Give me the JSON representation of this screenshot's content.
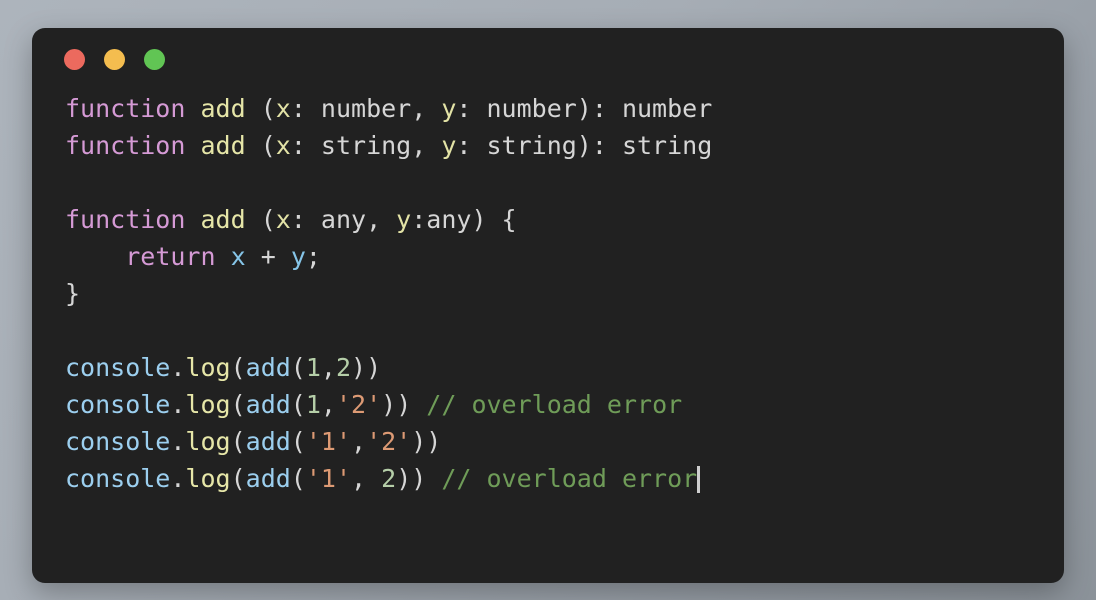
{
  "window": {
    "title": "code-snippet-window",
    "background_color": "#212121",
    "page_background": "#a8afb7",
    "controls": [
      {
        "name": "close-button",
        "label": "Close",
        "color": "#ec6a5e"
      },
      {
        "name": "minimize-button",
        "label": "Minimize",
        "color": "#f4bd4f"
      },
      {
        "name": "maximize-button",
        "label": "Maximize",
        "color": "#61c554"
      }
    ]
  },
  "editor": {
    "language": "typescript",
    "cursor_visible": true,
    "colors": {
      "keyword": "#d59ad5",
      "function_name": "#e6e6a8",
      "parameter": "#e3e3a6",
      "variable": "#86c5e8",
      "number": "#b5cea8",
      "string": "#dd9a74",
      "comment": "#6f9c58",
      "plain": "#d6d6d6",
      "object": "#9ccfef"
    },
    "lines": [
      {
        "id": "line-1",
        "text": "function add (x: number, y: number): number",
        "tokens": [
          {
            "t": "function",
            "c": "t-kw"
          },
          {
            "t": " ",
            "c": "t-plain"
          },
          {
            "t": "add",
            "c": "t-fn"
          },
          {
            "t": " (",
            "c": "t-plain"
          },
          {
            "t": "x",
            "c": "t-param"
          },
          {
            "t": ": number, ",
            "c": "t-plain"
          },
          {
            "t": "y",
            "c": "t-param"
          },
          {
            "t": ": number): number",
            "c": "t-plain"
          }
        ]
      },
      {
        "id": "line-2",
        "text": "function add (x: string, y: string): string",
        "tokens": [
          {
            "t": "function",
            "c": "t-kw"
          },
          {
            "t": " ",
            "c": "t-plain"
          },
          {
            "t": "add",
            "c": "t-fn"
          },
          {
            "t": " (",
            "c": "t-plain"
          },
          {
            "t": "x",
            "c": "t-param"
          },
          {
            "t": ": string, ",
            "c": "t-plain"
          },
          {
            "t": "y",
            "c": "t-param"
          },
          {
            "t": ": string): string",
            "c": "t-plain"
          }
        ]
      },
      {
        "id": "line-3",
        "text": "",
        "tokens": []
      },
      {
        "id": "line-4",
        "text": "function add (x: any, y:any) {",
        "tokens": [
          {
            "t": "function",
            "c": "t-kw"
          },
          {
            "t": " ",
            "c": "t-plain"
          },
          {
            "t": "add",
            "c": "t-fn"
          },
          {
            "t": " (",
            "c": "t-plain"
          },
          {
            "t": "x",
            "c": "t-param"
          },
          {
            "t": ": any, ",
            "c": "t-plain"
          },
          {
            "t": "y",
            "c": "t-param"
          },
          {
            "t": ":any) {",
            "c": "t-plain"
          }
        ]
      },
      {
        "id": "line-5",
        "text": "    return x + y;",
        "tokens": [
          {
            "t": "    ",
            "c": "t-plain"
          },
          {
            "t": "return",
            "c": "t-kw"
          },
          {
            "t": " ",
            "c": "t-plain"
          },
          {
            "t": "x",
            "c": "t-var"
          },
          {
            "t": " + ",
            "c": "t-plain"
          },
          {
            "t": "y",
            "c": "t-var"
          },
          {
            "t": ";",
            "c": "t-plain"
          }
        ]
      },
      {
        "id": "line-6",
        "text": "}",
        "tokens": [
          {
            "t": "}",
            "c": "t-plain"
          }
        ]
      },
      {
        "id": "line-7",
        "text": "",
        "tokens": []
      },
      {
        "id": "line-8",
        "text": "console.log(add(1,2))",
        "tokens": [
          {
            "t": "console",
            "c": "t-obj"
          },
          {
            "t": ".",
            "c": "t-plain"
          },
          {
            "t": "log",
            "c": "t-method"
          },
          {
            "t": "(",
            "c": "t-plain"
          },
          {
            "t": "add",
            "c": "t-obj"
          },
          {
            "t": "(",
            "c": "t-plain"
          },
          {
            "t": "1",
            "c": "t-num"
          },
          {
            "t": ",",
            "c": "t-plain"
          },
          {
            "t": "2",
            "c": "t-num"
          },
          {
            "t": "))",
            "c": "t-plain"
          }
        ]
      },
      {
        "id": "line-9",
        "text": "console.log(add(1,'2')) // overload error",
        "tokens": [
          {
            "t": "console",
            "c": "t-obj"
          },
          {
            "t": ".",
            "c": "t-plain"
          },
          {
            "t": "log",
            "c": "t-method"
          },
          {
            "t": "(",
            "c": "t-plain"
          },
          {
            "t": "add",
            "c": "t-obj"
          },
          {
            "t": "(",
            "c": "t-plain"
          },
          {
            "t": "1",
            "c": "t-num"
          },
          {
            "t": ",",
            "c": "t-plain"
          },
          {
            "t": "'2'",
            "c": "t-str"
          },
          {
            "t": ")) ",
            "c": "t-plain"
          },
          {
            "t": "// overload error",
            "c": "t-comment"
          }
        ]
      },
      {
        "id": "line-10",
        "text": "console.log(add('1','2'))",
        "tokens": [
          {
            "t": "console",
            "c": "t-obj"
          },
          {
            "t": ".",
            "c": "t-plain"
          },
          {
            "t": "log",
            "c": "t-method"
          },
          {
            "t": "(",
            "c": "t-plain"
          },
          {
            "t": "add",
            "c": "t-obj"
          },
          {
            "t": "(",
            "c": "t-plain"
          },
          {
            "t": "'1'",
            "c": "t-str"
          },
          {
            "t": ",",
            "c": "t-plain"
          },
          {
            "t": "'2'",
            "c": "t-str"
          },
          {
            "t": "))",
            "c": "t-plain"
          }
        ]
      },
      {
        "id": "line-11",
        "text": "console.log(add('1', 2)) // overload error",
        "caret": true,
        "tokens": [
          {
            "t": "console",
            "c": "t-obj"
          },
          {
            "t": ".",
            "c": "t-plain"
          },
          {
            "t": "log",
            "c": "t-method"
          },
          {
            "t": "(",
            "c": "t-plain"
          },
          {
            "t": "add",
            "c": "t-obj"
          },
          {
            "t": "(",
            "c": "t-plain"
          },
          {
            "t": "'1'",
            "c": "t-str"
          },
          {
            "t": ", ",
            "c": "t-plain"
          },
          {
            "t": "2",
            "c": "t-num"
          },
          {
            "t": ")) ",
            "c": "t-plain"
          },
          {
            "t": "// overload error",
            "c": "t-comment"
          }
        ]
      }
    ]
  }
}
